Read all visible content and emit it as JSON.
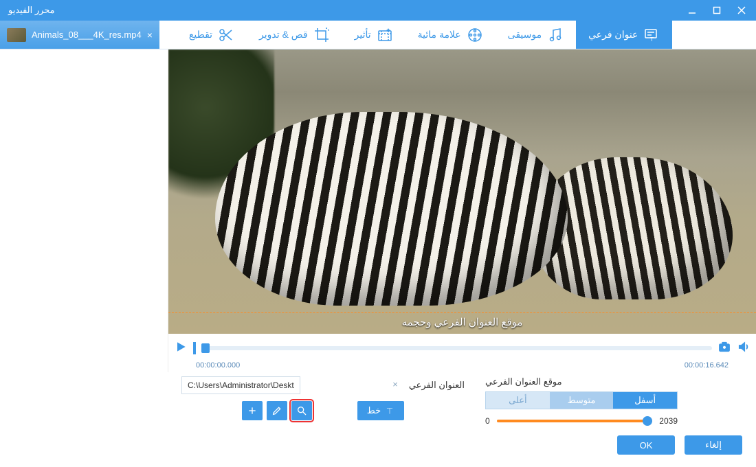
{
  "window": {
    "title": "محرر الفيديو"
  },
  "file_tab": {
    "name": "Animals_08___4K_res.mp4"
  },
  "tools": [
    {
      "id": "trim",
      "label": "تقطيع"
    },
    {
      "id": "crop",
      "label": "قص & تدوير"
    },
    {
      "id": "effect",
      "label": "تأثير"
    },
    {
      "id": "watermark",
      "label": "علامة مائية"
    },
    {
      "id": "music",
      "label": "موسيقى"
    },
    {
      "id": "subtitle",
      "label": "عنوان فرعي",
      "active": true
    }
  ],
  "preview": {
    "subtitle_placeholder": "موقع العنوان الفرعي وحجمه",
    "time_current": "00:00:00.000",
    "time_total": "00:00:16.642"
  },
  "subtitle_panel": {
    "label": "العنوان الفرعي",
    "path": "C:\\Users\\Administrator\\Desktop\\subtitle.srt",
    "font_label": "خط"
  },
  "position_panel": {
    "label": "موقع العنوان الفرعي",
    "options": {
      "bottom": "أسفل",
      "middle": "متوسط",
      "top": "أعلى"
    },
    "slider": {
      "min": "0",
      "max": "2039"
    }
  },
  "footer": {
    "ok": "OK",
    "cancel": "إلغاء"
  }
}
